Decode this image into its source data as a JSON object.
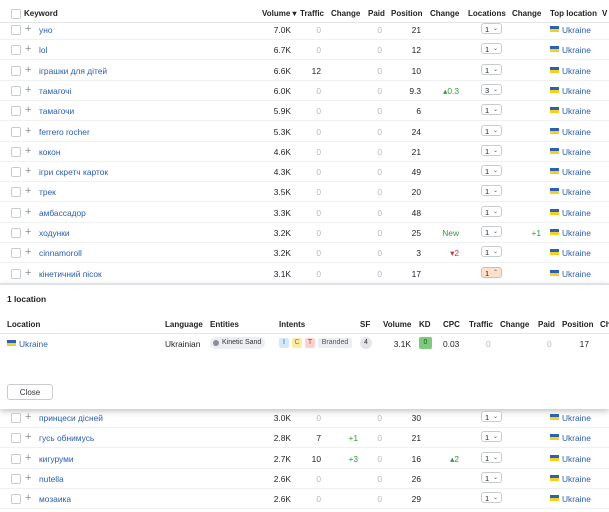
{
  "header": {
    "keyword": "Keyword",
    "volume": "Volume ▾",
    "traffic": "Traffic",
    "change1": "Change",
    "paid": "Paid",
    "position": "Position",
    "change2": "Change",
    "locations": "Locations",
    "change3": "Change",
    "top_location": "Top location",
    "overflow": "V"
  },
  "rows_top": [
    {
      "keyword": "уно",
      "volume": "7.0K",
      "traffic": "0",
      "change1": "",
      "paid": "0",
      "position": "21",
      "change2": "",
      "locations": "1",
      "change3": "",
      "top_location": "Ukraine"
    },
    {
      "keyword": "lol",
      "volume": "6.7K",
      "traffic": "0",
      "change1": "",
      "paid": "0",
      "position": "12",
      "change2": "",
      "locations": "1",
      "change3": "",
      "top_location": "Ukraine"
    },
    {
      "keyword": "іграшки для дітей",
      "volume": "6.6K",
      "traffic": "12",
      "change1": "",
      "paid": "0",
      "position": "10",
      "change2": "",
      "locations": "1",
      "change3": "",
      "top_location": "Ukraine"
    },
    {
      "keyword": "тамагочі",
      "volume": "6.0K",
      "traffic": "0",
      "change1": "",
      "paid": "0",
      "position": "9.3",
      "change2": "▴0.3",
      "locations": "3",
      "change3": "",
      "top_location": "Ukraine"
    },
    {
      "keyword": "тамагочи",
      "volume": "5.9K",
      "traffic": "0",
      "change1": "",
      "paid": "0",
      "position": "6",
      "change2": "",
      "locations": "1",
      "change3": "",
      "top_location": "Ukraine"
    },
    {
      "keyword": "ferrero rocher",
      "volume": "5.3K",
      "traffic": "0",
      "change1": "",
      "paid": "0",
      "position": "24",
      "change2": "",
      "locations": "1",
      "change3": "",
      "top_location": "Ukraine"
    },
    {
      "keyword": "кокон",
      "volume": "4.6K",
      "traffic": "0",
      "change1": "",
      "paid": "0",
      "position": "21",
      "change2": "",
      "locations": "1",
      "change3": "",
      "top_location": "Ukraine"
    },
    {
      "keyword": "ігри скретч карток",
      "volume": "4.3K",
      "traffic": "0",
      "change1": "",
      "paid": "0",
      "position": "49",
      "change2": "",
      "locations": "1",
      "change3": "",
      "top_location": "Ukraine"
    },
    {
      "keyword": "трек",
      "volume": "3.5K",
      "traffic": "0",
      "change1": "",
      "paid": "0",
      "position": "20",
      "change2": "",
      "locations": "1",
      "change3": "",
      "top_location": "Ukraine"
    },
    {
      "keyword": "амбассадор",
      "volume": "3.3K",
      "traffic": "0",
      "change1": "",
      "paid": "0",
      "position": "48",
      "change2": "",
      "locations": "1",
      "change3": "",
      "top_location": "Ukraine"
    },
    {
      "keyword": "ходунки",
      "volume": "3.2K",
      "traffic": "0",
      "change1": "",
      "paid": "0",
      "position": "25",
      "change2": "New",
      "locations": "1",
      "change3": "+1",
      "top_location": "Ukraine"
    },
    {
      "keyword": "cinnamoroll",
      "volume": "3.2K",
      "traffic": "0",
      "change1": "",
      "paid": "0",
      "position": "3",
      "change2": "▾2",
      "locations": "1",
      "change3": "",
      "top_location": "Ukraine"
    },
    {
      "keyword": "кінетичний пісок",
      "volume": "3.1K",
      "traffic": "0",
      "change1": "",
      "paid": "0",
      "position": "17",
      "change2": "",
      "locations": "1",
      "change3": "",
      "top_location": "Ukraine"
    }
  ],
  "panel": {
    "title": "1 location",
    "columns": {
      "location": "Location",
      "language": "Language",
      "entities": "Entities",
      "intents": "Intents",
      "sf": "SF",
      "volume": "Volume",
      "kd": "KD",
      "cpc": "CPC",
      "traffic": "Traffic",
      "change": "Change",
      "paid": "Paid",
      "position": "Position",
      "overflow": "Ch"
    },
    "row": {
      "location": "Ukraine",
      "language": "Ukrainian",
      "entity": "Kinetic Sand",
      "intent_i": "I",
      "intent_c": "C",
      "intent_t": "T",
      "intent_branded": "Branded",
      "sf": "4",
      "volume": "3.1K",
      "kd": "0",
      "cpc": "0.03",
      "traffic": "0",
      "paid": "0",
      "position": "17"
    },
    "close_label": "Close"
  },
  "rows_bottom": [
    {
      "keyword": "принцеси дісней",
      "volume": "3.0K",
      "traffic": "0",
      "change1": "",
      "paid": "0",
      "position": "30",
      "change2": "",
      "locations": "1",
      "change3": "",
      "top_location": "Ukraine"
    },
    {
      "keyword": "гусь обнимусь",
      "volume": "2.8K",
      "traffic": "7",
      "change1": "+1",
      "paid": "0",
      "position": "21",
      "change2": "",
      "locations": "1",
      "change3": "",
      "top_location": "Ukraine"
    },
    {
      "keyword": "кигуруми",
      "volume": "2.7K",
      "traffic": "10",
      "change1": "+3",
      "paid": "0",
      "position": "16",
      "change2": "▴2",
      "locations": "1",
      "change3": "",
      "top_location": "Ukraine"
    },
    {
      "keyword": "nutella",
      "volume": "2.6K",
      "traffic": "0",
      "change1": "",
      "paid": "0",
      "position": "26",
      "change2": "",
      "locations": "1",
      "change3": "",
      "top_location": "Ukraine"
    },
    {
      "keyword": "мозаика",
      "volume": "2.6K",
      "traffic": "0",
      "change1": "",
      "paid": "0",
      "position": "29",
      "change2": "",
      "locations": "1",
      "change3": "",
      "top_location": "Ukraine"
    }
  ],
  "icons": {
    "plus": "add-icon",
    "caret": "chevron-down-icon",
    "flag": "ukraine-flag-icon",
    "entity": "entity-icon"
  },
  "colors": {
    "link": "#2a5db0",
    "positive": "#2f9a3a",
    "negative": "#d0312d",
    "kd_badge": "#7ec97e",
    "flag_blue": "#2d5fb5",
    "flag_yellow": "#f4d020"
  }
}
